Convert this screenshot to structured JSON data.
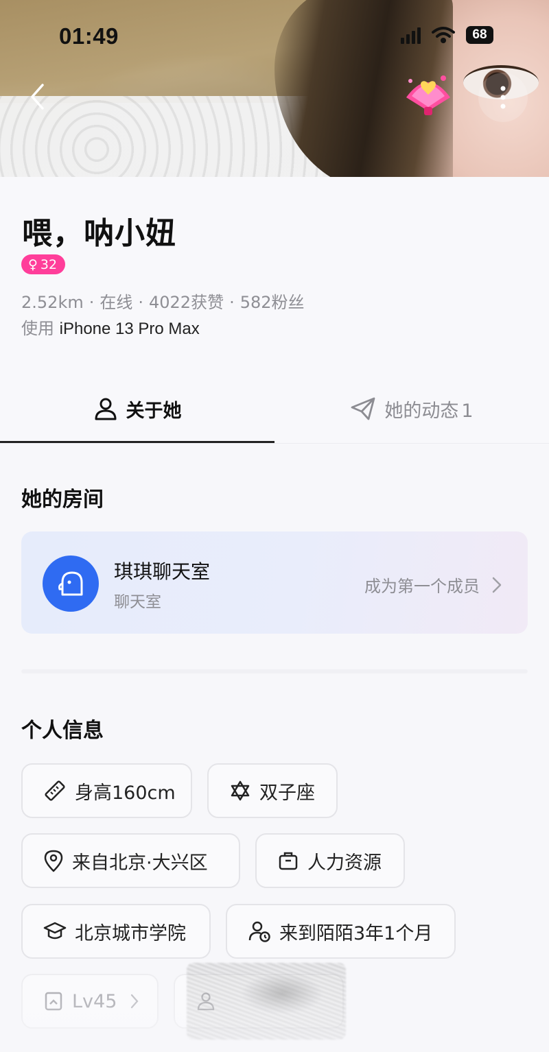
{
  "status_bar": {
    "time": "01:49",
    "battery": "68"
  },
  "header": {
    "back_icon": "chevron-left-icon",
    "gift_icon": "heart-fan-gift-icon",
    "more_icon": "more-vertical-icon"
  },
  "profile": {
    "name": "喂，呐小妞",
    "gender_symbol": "♀",
    "age": "32",
    "distance": "2.52km",
    "online": "在线",
    "likes": "4022获赞",
    "fans": "582粉丝",
    "separator": "·",
    "device_prefix": "使用",
    "device": "iPhone 13 Pro Max"
  },
  "tabs": [
    {
      "label": "关于她",
      "icon": "user-icon",
      "active": true
    },
    {
      "label": "她的动态",
      "count": "1",
      "icon": "send-icon",
      "active": false
    }
  ],
  "room_section": {
    "title": "她的房间",
    "room_name": "琪琪聊天室",
    "room_type": "聊天室",
    "cta": "成为第一个成员"
  },
  "info_section": {
    "title": "个人信息",
    "chips": [
      {
        "icon": "ruler-icon",
        "label": "身高160cm"
      },
      {
        "icon": "star-of-david-icon",
        "label": "双子座"
      },
      {
        "icon": "location-pin-icon",
        "label": "来自北京·大兴区"
      },
      {
        "icon": "briefcase-icon",
        "label": "人力资源"
      },
      {
        "icon": "graduation-cap-icon",
        "label": "北京城市学院"
      },
      {
        "icon": "user-clock-icon",
        "label": "来到陌陌3年1个月"
      },
      {
        "icon": "level-badge-icon",
        "label": "Lv45"
      },
      {
        "icon": "user-icon",
        "label": ""
      }
    ]
  },
  "colors": {
    "accent_pink": "#ff3e9a",
    "room_blue": "#2f6bf2",
    "text_primary": "#111111",
    "text_secondary": "#8e8e94"
  }
}
